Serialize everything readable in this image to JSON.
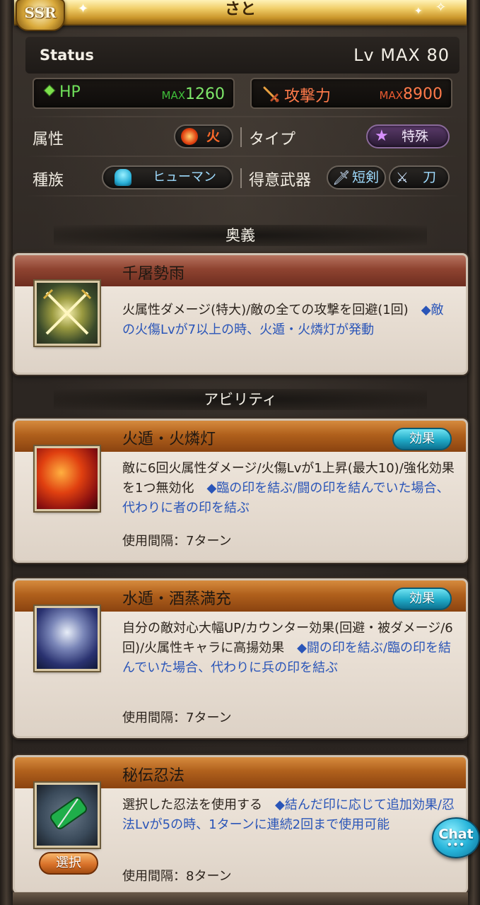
{
  "header": {
    "character_name": "さと",
    "rarity_badge": "SSR"
  },
  "status": {
    "label": "Status",
    "level": "Lv MAX 80",
    "hp": {
      "name": "HP",
      "max_prefix": "MAX",
      "value": "1260"
    },
    "attack": {
      "name": "攻撃力",
      "max_prefix": "MAX",
      "value": "8900"
    },
    "element_label": "属性",
    "element_value": "火",
    "type_label": "タイプ",
    "type_value": "特殊",
    "race_label": "種族",
    "race_value": "ヒューマン",
    "weapon_label": "得意武器",
    "weapons": [
      "短剣",
      "刀"
    ]
  },
  "ougi_section": {
    "heading": "奥義",
    "title": "千屠勢雨",
    "desc_plain": "火属性ダメージ(特大)/敵の全ての攻撃を回避(1回)",
    "desc_blue": "◆敵の火傷Lvが7以上の時、火遁・火燐灯が発動"
  },
  "ability_section": {
    "heading": "アビリティ",
    "abilities": [
      {
        "title": "火遁・火燐灯",
        "effect_button": "効果",
        "desc_plain": "敵に6回火属性ダメージ/火傷Lvが1上昇(最大10)/強化効果を1つ無効化",
        "desc_blue": "◆臨の印を結ぶ/闘の印を結んでいた場合、代わりに者の印を結ぶ",
        "cooldown": "使用間隔：7ターン"
      },
      {
        "title": "水遁・酒蒸満充",
        "effect_button": "効果",
        "desc_plain": "自分の敵対心大幅UP/カウンター効果(回避・被ダメージ/6回)/火属性キャラに高揚効果",
        "desc_blue": "◆闘の印を結ぶ/臨の印を結んでいた場合、代わりに兵の印を結ぶ",
        "cooldown": "使用間隔：7ターン"
      },
      {
        "title": "秘伝忍法",
        "select_button": "選択",
        "desc_plain": "選択した忍法を使用する",
        "desc_blue": "◆結んだ印に応じて追加効果/忍法Lvが5の時、1ターンに連続2回まで使用可能",
        "cooldown": "使用間隔：8ターン"
      }
    ]
  },
  "chat_button": "Chat",
  "colors": {
    "hp_green": "#7ee86a",
    "attack_orange": "#ff7a4a",
    "description_blue": "#2a55b8",
    "effect_button_cyan": "#1fa9c6",
    "select_button_orange": "#d9722a"
  },
  "icons": {
    "ougi": "crossed-swords-icon",
    "ability_1": "fire-explosion-icon",
    "ability_2": "water-mist-icon",
    "ability_3": "scroll-icon"
  }
}
